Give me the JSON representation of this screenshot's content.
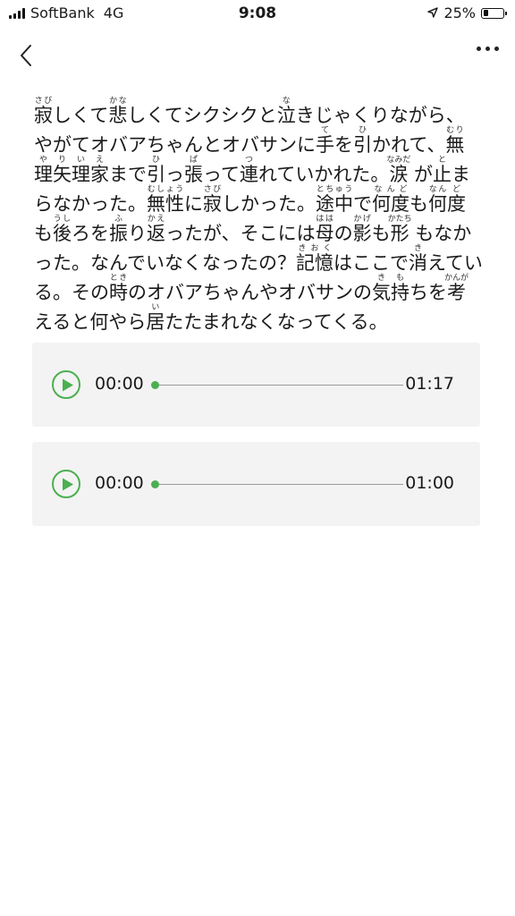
{
  "status_bar": {
    "carrier": "SoftBank",
    "network": "4G",
    "time": "9:08",
    "battery_percent": "25%",
    "battery_level": 0.25
  },
  "nav": {
    "back_icon": "chevron-left-icon",
    "more_icon": "ellipsis-icon"
  },
  "article": {
    "segments": [
      {
        "base": "寂",
        "ruby": "さび"
      },
      {
        "text": "しくて"
      },
      {
        "base": "悲",
        "ruby": "かな"
      },
      {
        "text": "しくてシクシクと"
      },
      {
        "base": "泣",
        "ruby": "な"
      },
      {
        "text": "きじゃくりながら、やがてオバアちゃんとオバサンに"
      },
      {
        "base": "手",
        "ruby": "て"
      },
      {
        "text": "を"
      },
      {
        "base": "引",
        "ruby": "ひ"
      },
      {
        "text": "かれて、"
      },
      {
        "base": "無理矢理家",
        "ruby": "むりやりいえ"
      },
      {
        "text": "まで"
      },
      {
        "base": "引",
        "ruby": "ひ"
      },
      {
        "text": "っ"
      },
      {
        "base": "張",
        "ruby": "ぱ"
      },
      {
        "text": "って"
      },
      {
        "base": "連",
        "ruby": "つ"
      },
      {
        "text": "れていかれた。"
      },
      {
        "base": "涙",
        "ruby": "なみだ"
      },
      {
        "text": " が"
      },
      {
        "base": "止",
        "ruby": "と"
      },
      {
        "text": "まらなかった。"
      },
      {
        "base": "無性",
        "ruby": "むしょう"
      },
      {
        "text": "に"
      },
      {
        "base": "寂",
        "ruby": "さび"
      },
      {
        "text": "しかった。"
      },
      {
        "base": "途中",
        "ruby": "とちゅう"
      },
      {
        "text": "で"
      },
      {
        "base": "何度",
        "ruby": "なんど"
      },
      {
        "text": "も"
      },
      {
        "base": "何",
        "ruby": "なん"
      },
      {
        "base": "度",
        "ruby": "ど"
      },
      {
        "text": "も"
      },
      {
        "base": "後",
        "ruby": "うし"
      },
      {
        "text": "ろを"
      },
      {
        "base": "振",
        "ruby": "ふ"
      },
      {
        "text": "り"
      },
      {
        "base": "返",
        "ruby": "かえ"
      },
      {
        "text": "ったが、そこには"
      },
      {
        "base": "母",
        "ruby": "はは"
      },
      {
        "text": "の"
      },
      {
        "base": "影",
        "ruby": "かげ"
      },
      {
        "text": "も"
      },
      {
        "base": "形",
        "ruby": "かたち"
      },
      {
        "text": " もなかった。なんでいなくなったの？"
      },
      {
        "base": "記憶",
        "ruby": "きおく"
      },
      {
        "text": "はここで"
      },
      {
        "base": "消",
        "ruby": "き"
      },
      {
        "text": "えている。その"
      },
      {
        "base": "時",
        "ruby": "とき"
      },
      {
        "text": "のオバアちゃんやオバサンの"
      },
      {
        "base": "気持",
        "ruby": "きも"
      },
      {
        "text": "ちを"
      },
      {
        "base": "考",
        "ruby": "かんが"
      },
      {
        "text": "えると"
      },
      {
        "base": "何",
        "ruby": ""
      },
      {
        "text": "やら"
      },
      {
        "base": "居",
        "ruby": "い"
      },
      {
        "text": "たたまれなくなってくる。"
      }
    ]
  },
  "audio_players": [
    {
      "current_time": "00:00",
      "total_time": "01:17",
      "progress": 0,
      "play_icon": "play-icon"
    },
    {
      "current_time": "00:00",
      "total_time": "01:00",
      "progress": 0,
      "play_icon": "play-icon"
    }
  ],
  "colors": {
    "accent": "#4caf50",
    "card_background": "#f3f3f3",
    "text": "#1a1a1a"
  }
}
